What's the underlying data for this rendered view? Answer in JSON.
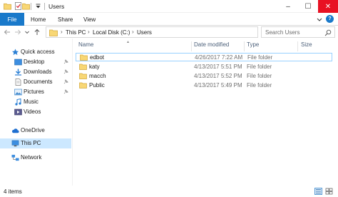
{
  "window": {
    "title": "Users",
    "controls": {
      "minimize": "–",
      "maximize": "☐",
      "close": "✕"
    }
  },
  "ribbon": {
    "tabs": [
      "File",
      "Home",
      "Share",
      "View"
    ],
    "help": "?"
  },
  "address": {
    "crumbs": [
      "This PC",
      "Local Disk (C:)",
      "Users"
    ],
    "separator": "›",
    "search_placeholder": "Search Users"
  },
  "navigation": {
    "quick_access": "Quick access",
    "pinned": [
      "Desktop",
      "Downloads",
      "Documents",
      "Pictures"
    ],
    "unpinned": [
      "Music",
      "Videos"
    ],
    "onedrive": "OneDrive",
    "this_pc": "This PC",
    "network": "Network"
  },
  "columns": {
    "name": "Name",
    "date": "Date modified",
    "type": "Type",
    "size": "Size"
  },
  "files": [
    {
      "name": "edbot",
      "date": "4/26/2017 7:22 AM",
      "type": "File folder"
    },
    {
      "name": "katy",
      "date": "4/13/2017 5:51 PM",
      "type": "File folder"
    },
    {
      "name": "macch",
      "date": "4/13/2017 5:52 PM",
      "type": "File folder"
    },
    {
      "name": "Public",
      "date": "4/13/2017 5:49 PM",
      "type": "File folder"
    }
  ],
  "status": {
    "item_count": "4 items"
  },
  "colors": {
    "accent": "#1979ca",
    "selection": "#cce8ff",
    "folder": "#f8d775",
    "folder_dark": "#e0b34a"
  }
}
